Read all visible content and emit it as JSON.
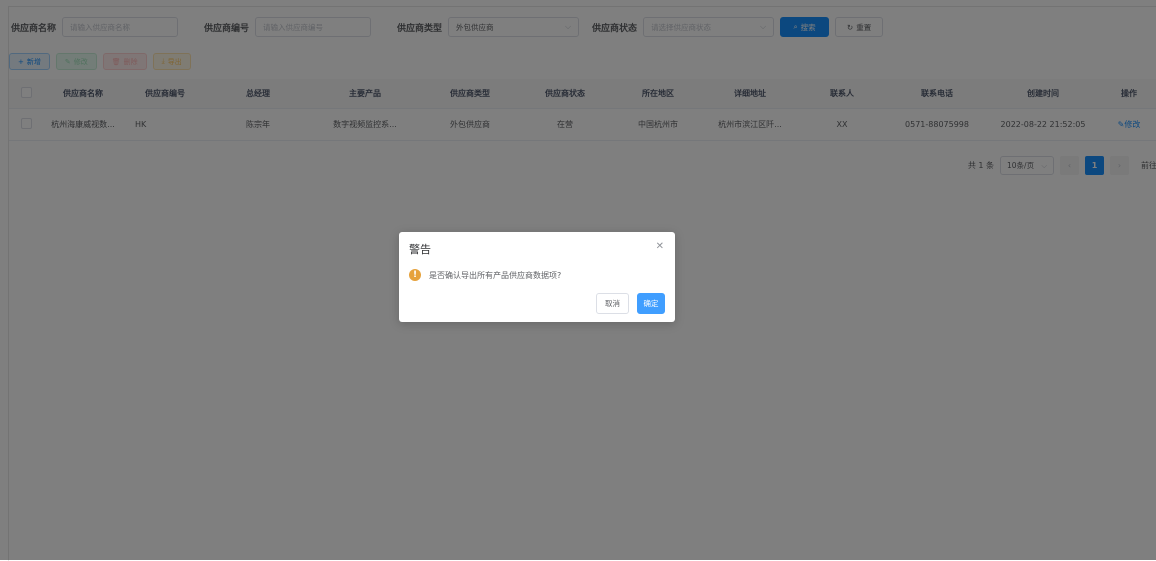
{
  "search": {
    "name_label": "供应商名称",
    "name_placeholder": "请输入供应商名称",
    "code_label": "供应商编号",
    "code_placeholder": "请输入供应商编号",
    "type_label": "供应商类型",
    "type_value": "外包供应商",
    "status_label": "供应商状态",
    "status_placeholder": "请选择供应商状态",
    "search_button": "搜索",
    "reset_button": "重置"
  },
  "toolbar": {
    "add": "新增",
    "edit": "修改",
    "delete": "删除",
    "export": "导出"
  },
  "table": {
    "headers": [
      "供应商名称",
      "供应商编号",
      "总经理",
      "主要产品",
      "供应商类型",
      "供应商状态",
      "所在地区",
      "详细地址",
      "联系人",
      "联系电话",
      "创建时间",
      "操作"
    ],
    "rows": [
      {
        "name": "杭州海康威视数...",
        "code": "HK",
        "manager": "陈宗年",
        "product": "数字视频监控系...",
        "type": "外包供应商",
        "status": "在营",
        "region": "中国杭州市",
        "address": "杭州市滨江区阡...",
        "contact": "XX",
        "phone": "0571-88075998",
        "created": "2022-08-22 21:52:05",
        "action": "修改"
      }
    ]
  },
  "pagination": {
    "total": "共 1 条",
    "page_size": "10条/页",
    "current_page": "1",
    "goto": "前往"
  },
  "dialog": {
    "title": "警告",
    "message": "是否确认导出所有产品供应商数据项?",
    "cancel": "取消",
    "confirm": "确定"
  },
  "colors": {
    "primary": "#1890ff",
    "warning": "#e6a23c"
  }
}
